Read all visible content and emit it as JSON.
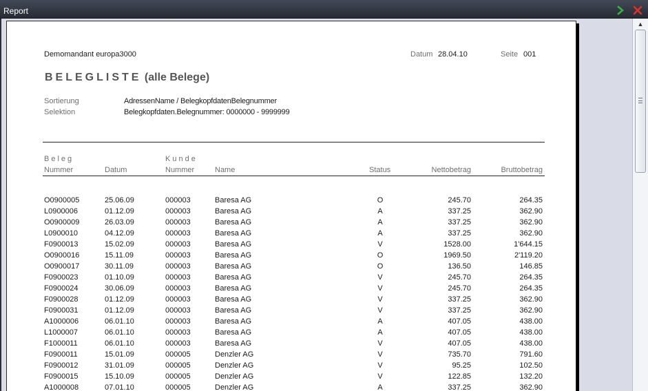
{
  "window": {
    "title": "Report"
  },
  "header": {
    "company": "Demomandant europa3000",
    "date_label": "Datum",
    "date_value": "28.04.10",
    "page_label": "Seite",
    "page_value": "001",
    "title_spaced": "BELEGLISTE",
    "title_rest": "(alle Belege)",
    "sort_label": "Sortierung",
    "sort_value": "AdressenName / BelegkopfdatenBelegnummer",
    "selection_label": "Selektion",
    "selection_value": "Belegkopfdaten.Belegnummer: 0000000 - 9999999"
  },
  "table": {
    "group_beleg": "Beleg",
    "group_kunde": "Kunde",
    "columns": {
      "beleg_nummer": "Nummer",
      "datum": "Datum",
      "kunde_nummer": "Nummer",
      "name": "Name",
      "status": "Status",
      "netto": "Nettobetrag",
      "brutto": "Bruttobetrag"
    },
    "rows": [
      {
        "nr": "O0900005",
        "datum": "25.06.09",
        "kunde": "000003",
        "name": "Baresa  AG",
        "status": "O",
        "netto": "245.70",
        "brutto": "264.35"
      },
      {
        "nr": "L0900006",
        "datum": "01.12.09",
        "kunde": "000003",
        "name": "Baresa  AG",
        "status": "A",
        "netto": "337.25",
        "brutto": "362.90"
      },
      {
        "nr": "O0900009",
        "datum": "26.03.09",
        "kunde": "000003",
        "name": "Baresa  AG",
        "status": "A",
        "netto": "337.25",
        "brutto": "362.90"
      },
      {
        "nr": "L0900010",
        "datum": "04.12.09",
        "kunde": "000003",
        "name": "Baresa  AG",
        "status": "A",
        "netto": "337.25",
        "brutto": "362.90"
      },
      {
        "nr": "F0900013",
        "datum": "15.02.09",
        "kunde": "000003",
        "name": "Baresa  AG",
        "status": "V",
        "netto": "1528.00",
        "brutto": "1'644.15"
      },
      {
        "nr": "O0900016",
        "datum": "15.11.09",
        "kunde": "000003",
        "name": "Baresa  AG",
        "status": "O",
        "netto": "1969.50",
        "brutto": "2'119.20"
      },
      {
        "nr": "O0900017",
        "datum": "30.11.09",
        "kunde": "000003",
        "name": "Baresa  AG",
        "status": "O",
        "netto": "136.50",
        "brutto": "146.85"
      },
      {
        "nr": "F0900023",
        "datum": "01.10.09",
        "kunde": "000003",
        "name": "Baresa  AG",
        "status": "V",
        "netto": "245.70",
        "brutto": "264.35"
      },
      {
        "nr": "F0900024",
        "datum": "30.06.09",
        "kunde": "000003",
        "name": "Baresa  AG",
        "status": "V",
        "netto": "245.70",
        "brutto": "264.35"
      },
      {
        "nr": "F0900028",
        "datum": "01.12.09",
        "kunde": "000003",
        "name": "Baresa  AG",
        "status": "V",
        "netto": "337.25",
        "brutto": "362.90"
      },
      {
        "nr": "F0900031",
        "datum": "01.12.09",
        "kunde": "000003",
        "name": "Baresa  AG",
        "status": "V",
        "netto": "337.25",
        "brutto": "362.90"
      },
      {
        "nr": "A1000006",
        "datum": "06.01.10",
        "kunde": "000003",
        "name": "Baresa  AG",
        "status": "A",
        "netto": "407.05",
        "brutto": "438.00"
      },
      {
        "nr": "L1000007",
        "datum": "06.01.10",
        "kunde": "000003",
        "name": "Baresa  AG",
        "status": "A",
        "netto": "407.05",
        "brutto": "438.00"
      },
      {
        "nr": "F1000011",
        "datum": "06.01.10",
        "kunde": "000003",
        "name": "Baresa  AG",
        "status": "V",
        "netto": "407.05",
        "brutto": "438.00"
      },
      {
        "nr": "F0900011",
        "datum": "15.01.09",
        "kunde": "000005",
        "name": "Denzler AG",
        "status": "V",
        "netto": "735.70",
        "brutto": "791.60"
      },
      {
        "nr": "F0900012",
        "datum": "31.01.09",
        "kunde": "000005",
        "name": "Denzler AG",
        "status": "V",
        "netto": "95.25",
        "brutto": "102.50"
      },
      {
        "nr": "F0900015",
        "datum": "15.10.09",
        "kunde": "000005",
        "name": "Denzler AG",
        "status": "V",
        "netto": "122.85",
        "brutto": "132.20"
      },
      {
        "nr": "A1000008",
        "datum": "07.01.10",
        "kunde": "000005",
        "name": "Denzler AG",
        "status": "A",
        "netto": "337.25",
        "brutto": "362.90"
      }
    ]
  },
  "icons": {
    "next": "arrow-right-icon",
    "close": "close-icon",
    "next_color": "#3cb043",
    "close_color": "#e0302a"
  }
}
